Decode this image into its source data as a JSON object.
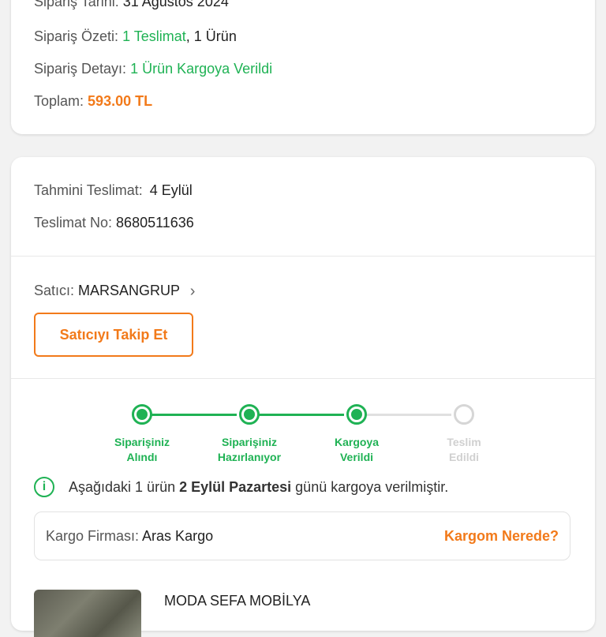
{
  "order": {
    "date_label": "Sipariş Tarihi:",
    "date_value": "31 Ağustos 2024",
    "summary_label": "Sipariş Özeti:",
    "summary_delivery": "1 Teslimat",
    "summary_sep": ",",
    "summary_items": "1 Ürün",
    "detail_label": "Sipariş Detayı:",
    "detail_value": "1 Ürün Kargoya Verildi",
    "total_label": "Toplam:",
    "total_value": "593.00 TL"
  },
  "delivery": {
    "estimate_label": "Tahmini Teslimat:",
    "estimate_value": "4 Eylül",
    "number_label": "Teslimat No:",
    "number_value": "8680511636"
  },
  "seller": {
    "label": "Satıcı:",
    "name": "MARSANGRUP",
    "follow_button": "Satıcıyı Takip Et"
  },
  "tracker": {
    "steps": [
      {
        "line1": "Siparişiniz",
        "line2": "Alındı",
        "done": true
      },
      {
        "line1": "Siparişiniz",
        "line2": "Hazırlanıyor",
        "done": true
      },
      {
        "line1": "Kargoya",
        "line2": "Verildi",
        "done": true
      },
      {
        "line1": "Teslim",
        "line2": "Edildi",
        "done": false
      }
    ]
  },
  "info": {
    "icon": "info-icon",
    "text_pre": "Aşağıdaki 1 ürün ",
    "text_bold": "2 Eylül Pazartesi",
    "text_post": " günü kargoya verilmiştir."
  },
  "cargo": {
    "label": "Kargo Firması:",
    "company": "Aras Kargo",
    "link": "Kargom Nerede?"
  },
  "product": {
    "name": "MODA SEFA MOBİLYA"
  },
  "colors": {
    "green": "#1fb254",
    "orange": "#f27a1a",
    "background": "#f2f2f2"
  }
}
